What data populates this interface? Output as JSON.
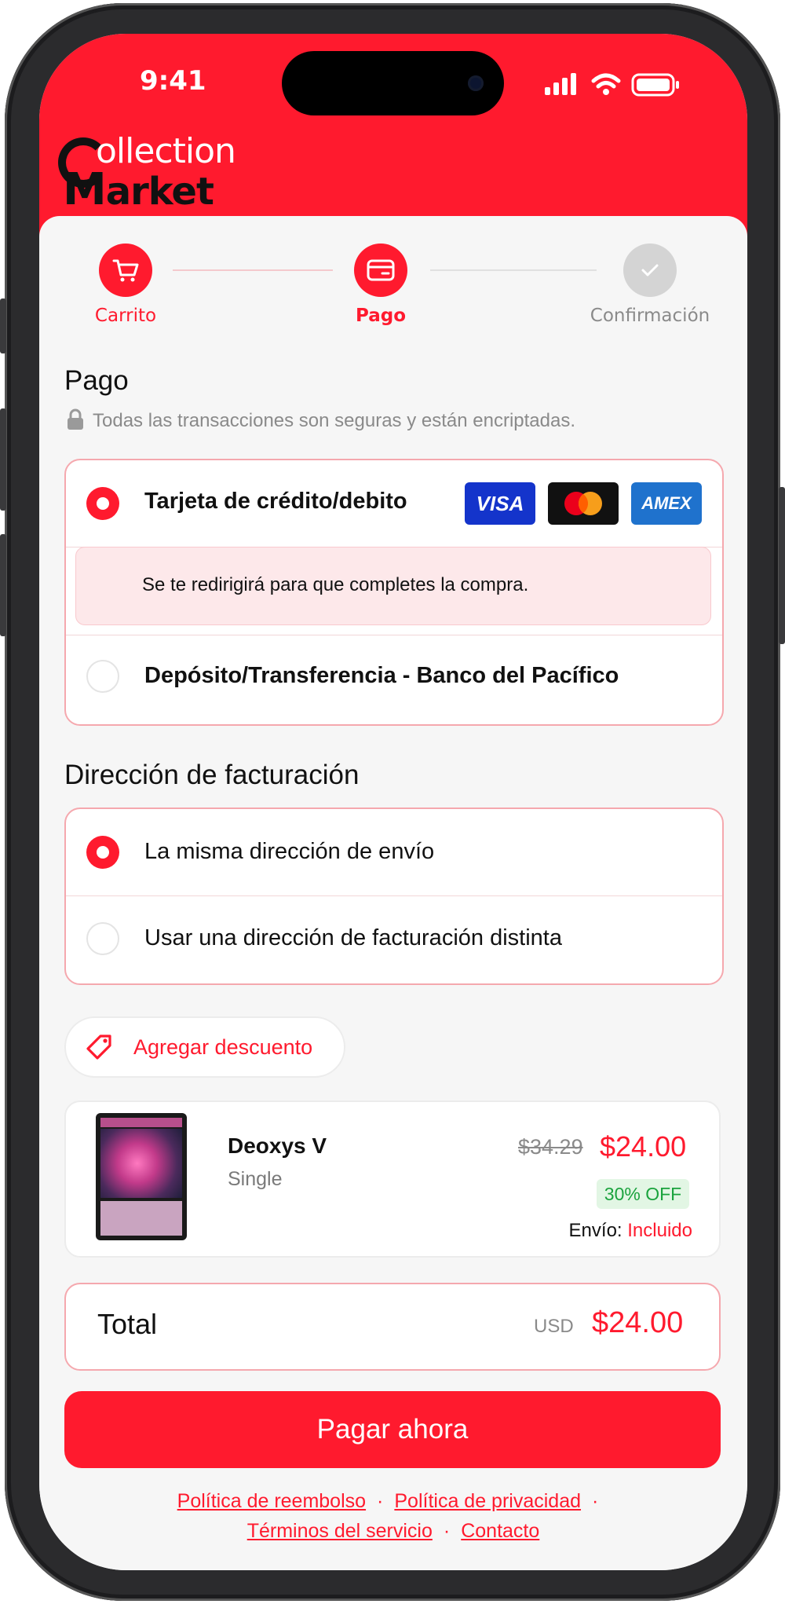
{
  "status_bar": {
    "time": "9:41"
  },
  "brand": {
    "line1": "ollection",
    "line2": "arket"
  },
  "steps": [
    {
      "label": "Carrito",
      "state": "done"
    },
    {
      "label": "Pago",
      "state": "active"
    },
    {
      "label": "Confirmación",
      "state": "pending"
    }
  ],
  "payment": {
    "title": "Pago",
    "secure_note": "Todas las transacciones son seguras y están encriptadas.",
    "option_card": "Tarjeta de crédito/debito",
    "card_brands": [
      "VISA",
      "AMEX"
    ],
    "redirect_note": "Se te redirigirá para que completes la compra.",
    "option_transfer": "Depósito/Transferencia - Banco del Pacífico"
  },
  "billing": {
    "title": "Dirección de facturación",
    "option_same": "La misma dirección de envío",
    "option_different": "Usar una dirección de facturación distinta"
  },
  "discount": {
    "label": "Agregar descuento"
  },
  "product": {
    "name": "Deoxys V",
    "type": "Single",
    "old_price": "$34.29",
    "price": "$24.00",
    "badge": "30% OFF",
    "shipping_label": "Envío:",
    "shipping_value": "Incluido"
  },
  "total": {
    "label": "Total",
    "currency": "USD",
    "amount": "$24.00"
  },
  "pay_button": "Pagar ahora",
  "footer_links": [
    "Política de reembolso",
    "Política de privacidad",
    "Términos del servicio",
    "Contacto"
  ],
  "colors": {
    "accent": "#ff1a2e",
    "discount_badge": "#e8f8ea"
  }
}
